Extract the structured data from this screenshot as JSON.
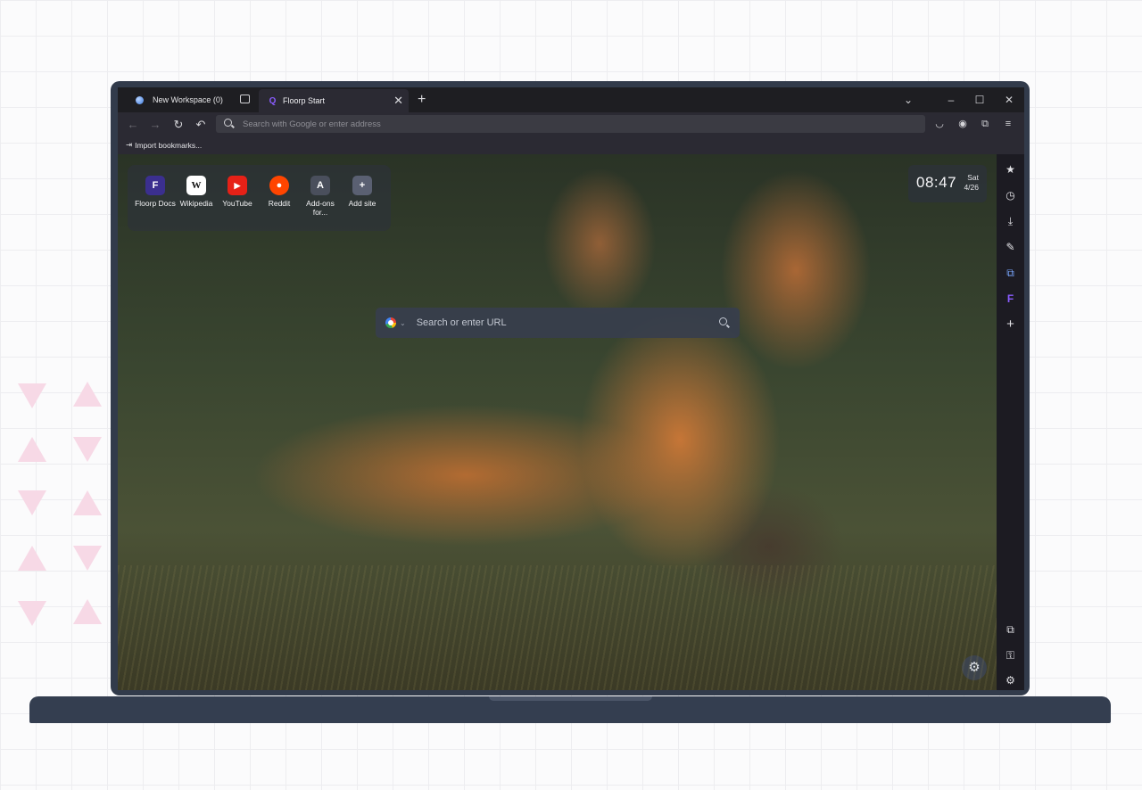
{
  "tabbar": {
    "workspace_label": "New Workspace (0)",
    "active_tab_title": "Floorp Start",
    "active_tab_icon": "Q",
    "close_glyph": "✕",
    "new_tab_glyph": "+",
    "list_all_glyph": "⌄",
    "minimize_glyph": "–",
    "maximize_glyph": "☐",
    "window_close_glyph": "✕"
  },
  "navbar": {
    "back_glyph": "←",
    "forward_glyph": "→",
    "reload_glyph": "↻",
    "undo_glyph": "↶",
    "url_placeholder": "Search with Google or enter address",
    "pocket_glyph": "◡",
    "account_glyph": "◉",
    "extensions_glyph": "⧉",
    "menu_glyph": "≡"
  },
  "bookmarks": {
    "import_icon": "⇥",
    "import_label": "Import bookmarks..."
  },
  "shortcuts": [
    {
      "label": "Floorp Docs",
      "glyph": "F",
      "bg": "#3b2f8f",
      "fg": "#ffffff"
    },
    {
      "label": "Wikipedia",
      "glyph": "W",
      "bg": "#ffffff",
      "fg": "#111111"
    },
    {
      "label": "YouTube",
      "glyph": "▶",
      "bg": "#e62117",
      "fg": "#ffffff"
    },
    {
      "label": "Reddit",
      "glyph": "●",
      "bg": "#ff4500",
      "fg": "#ffffff"
    },
    {
      "label": "Add-ons for...",
      "glyph": "A",
      "bg": "#4a4f5c",
      "fg": "#ffffff"
    },
    {
      "label": "Add site",
      "glyph": "+",
      "bg": "#5a6072",
      "fg": "#ffffff"
    }
  ],
  "clock": {
    "time": "08:47",
    "day": "Sat",
    "date": "4/26"
  },
  "search": {
    "placeholder": "Search or enter URL",
    "caret_glyph": "⌄"
  },
  "settings_glyph": "⚙",
  "sidebar": {
    "bookmarks_glyph": "★",
    "history_glyph": "◷",
    "downloads_glyph": "⤓",
    "notes_glyph": "✎",
    "translate_glyph": "⧉",
    "floorp_glyph": "F",
    "add_glyph": "+",
    "extensions_glyph": "⧉",
    "passwords_glyph": "⚿",
    "settings_glyph": "⚙"
  },
  "colors": {
    "accent": "#8a5cff",
    "laptop": "#323b4b",
    "chrome": "#2b2a33"
  }
}
